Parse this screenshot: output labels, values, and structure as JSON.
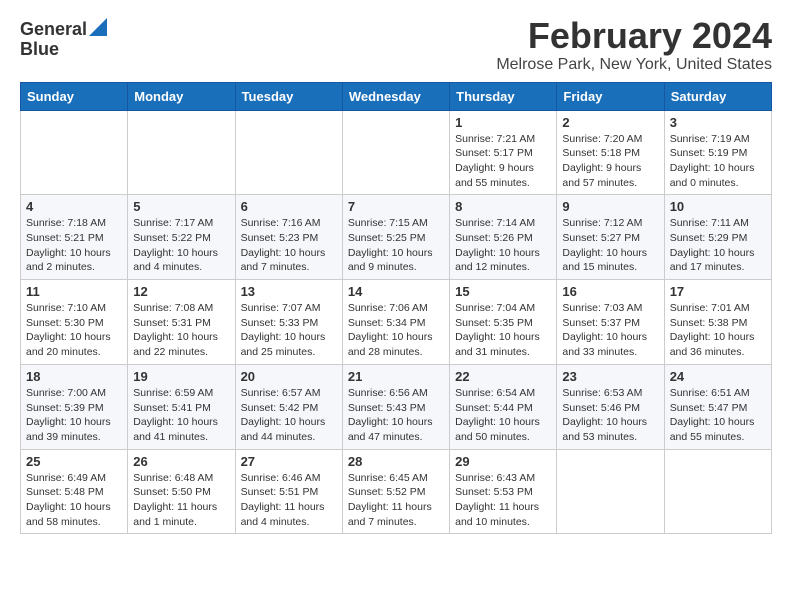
{
  "header": {
    "logo_line1": "General",
    "logo_line2": "Blue",
    "title": "February 2024",
    "subtitle": "Melrose Park, New York, United States"
  },
  "days_of_week": [
    "Sunday",
    "Monday",
    "Tuesday",
    "Wednesday",
    "Thursday",
    "Friday",
    "Saturday"
  ],
  "weeks": [
    [
      {
        "day": "",
        "info": ""
      },
      {
        "day": "",
        "info": ""
      },
      {
        "day": "",
        "info": ""
      },
      {
        "day": "",
        "info": ""
      },
      {
        "day": "1",
        "info": "Sunrise: 7:21 AM\nSunset: 5:17 PM\nDaylight: 9 hours\nand 55 minutes."
      },
      {
        "day": "2",
        "info": "Sunrise: 7:20 AM\nSunset: 5:18 PM\nDaylight: 9 hours\nand 57 minutes."
      },
      {
        "day": "3",
        "info": "Sunrise: 7:19 AM\nSunset: 5:19 PM\nDaylight: 10 hours\nand 0 minutes."
      }
    ],
    [
      {
        "day": "4",
        "info": "Sunrise: 7:18 AM\nSunset: 5:21 PM\nDaylight: 10 hours\nand 2 minutes."
      },
      {
        "day": "5",
        "info": "Sunrise: 7:17 AM\nSunset: 5:22 PM\nDaylight: 10 hours\nand 4 minutes."
      },
      {
        "day": "6",
        "info": "Sunrise: 7:16 AM\nSunset: 5:23 PM\nDaylight: 10 hours\nand 7 minutes."
      },
      {
        "day": "7",
        "info": "Sunrise: 7:15 AM\nSunset: 5:25 PM\nDaylight: 10 hours\nand 9 minutes."
      },
      {
        "day": "8",
        "info": "Sunrise: 7:14 AM\nSunset: 5:26 PM\nDaylight: 10 hours\nand 12 minutes."
      },
      {
        "day": "9",
        "info": "Sunrise: 7:12 AM\nSunset: 5:27 PM\nDaylight: 10 hours\nand 15 minutes."
      },
      {
        "day": "10",
        "info": "Sunrise: 7:11 AM\nSunset: 5:29 PM\nDaylight: 10 hours\nand 17 minutes."
      }
    ],
    [
      {
        "day": "11",
        "info": "Sunrise: 7:10 AM\nSunset: 5:30 PM\nDaylight: 10 hours\nand 20 minutes."
      },
      {
        "day": "12",
        "info": "Sunrise: 7:08 AM\nSunset: 5:31 PM\nDaylight: 10 hours\nand 22 minutes."
      },
      {
        "day": "13",
        "info": "Sunrise: 7:07 AM\nSunset: 5:33 PM\nDaylight: 10 hours\nand 25 minutes."
      },
      {
        "day": "14",
        "info": "Sunrise: 7:06 AM\nSunset: 5:34 PM\nDaylight: 10 hours\nand 28 minutes."
      },
      {
        "day": "15",
        "info": "Sunrise: 7:04 AM\nSunset: 5:35 PM\nDaylight: 10 hours\nand 31 minutes."
      },
      {
        "day": "16",
        "info": "Sunrise: 7:03 AM\nSunset: 5:37 PM\nDaylight: 10 hours\nand 33 minutes."
      },
      {
        "day": "17",
        "info": "Sunrise: 7:01 AM\nSunset: 5:38 PM\nDaylight: 10 hours\nand 36 minutes."
      }
    ],
    [
      {
        "day": "18",
        "info": "Sunrise: 7:00 AM\nSunset: 5:39 PM\nDaylight: 10 hours\nand 39 minutes."
      },
      {
        "day": "19",
        "info": "Sunrise: 6:59 AM\nSunset: 5:41 PM\nDaylight: 10 hours\nand 41 minutes."
      },
      {
        "day": "20",
        "info": "Sunrise: 6:57 AM\nSunset: 5:42 PM\nDaylight: 10 hours\nand 44 minutes."
      },
      {
        "day": "21",
        "info": "Sunrise: 6:56 AM\nSunset: 5:43 PM\nDaylight: 10 hours\nand 47 minutes."
      },
      {
        "day": "22",
        "info": "Sunrise: 6:54 AM\nSunset: 5:44 PM\nDaylight: 10 hours\nand 50 minutes."
      },
      {
        "day": "23",
        "info": "Sunrise: 6:53 AM\nSunset: 5:46 PM\nDaylight: 10 hours\nand 53 minutes."
      },
      {
        "day": "24",
        "info": "Sunrise: 6:51 AM\nSunset: 5:47 PM\nDaylight: 10 hours\nand 55 minutes."
      }
    ],
    [
      {
        "day": "25",
        "info": "Sunrise: 6:49 AM\nSunset: 5:48 PM\nDaylight: 10 hours\nand 58 minutes."
      },
      {
        "day": "26",
        "info": "Sunrise: 6:48 AM\nSunset: 5:50 PM\nDaylight: 11 hours\nand 1 minute."
      },
      {
        "day": "27",
        "info": "Sunrise: 6:46 AM\nSunset: 5:51 PM\nDaylight: 11 hours\nand 4 minutes."
      },
      {
        "day": "28",
        "info": "Sunrise: 6:45 AM\nSunset: 5:52 PM\nDaylight: 11 hours\nand 7 minutes."
      },
      {
        "day": "29",
        "info": "Sunrise: 6:43 AM\nSunset: 5:53 PM\nDaylight: 11 hours\nand 10 minutes."
      },
      {
        "day": "",
        "info": ""
      },
      {
        "day": "",
        "info": ""
      }
    ]
  ]
}
